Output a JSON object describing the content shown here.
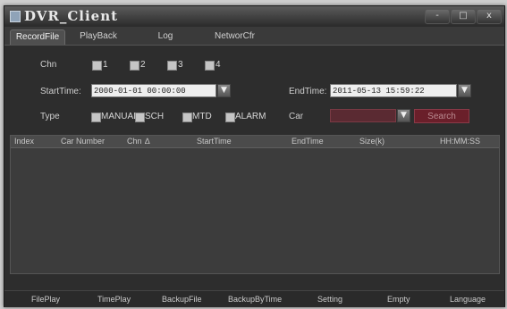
{
  "window": {
    "title": "DVR_Client",
    "min_label": "-",
    "max_label": "□",
    "close_label": "x"
  },
  "tabs": [
    {
      "label": "RecordFile",
      "active": true
    },
    {
      "label": "PlayBack"
    },
    {
      "label": "Log"
    },
    {
      "label": "NetworCfr"
    }
  ],
  "filters": {
    "chn_label": "Chn",
    "channels": [
      "1",
      "2",
      "3",
      "4"
    ],
    "start_label": "StartTime:",
    "start_value": "2000-01-01 00:00:00",
    "end_label": "EndTime:",
    "end_value": "2011-05-13 15:59:22",
    "type_label": "Type",
    "types": [
      "MANUAL",
      "SCH",
      "MTD",
      "ALARM"
    ],
    "car_label": "Car",
    "car_value": "",
    "search_label": "Search"
  },
  "table": {
    "columns": [
      "Index",
      "Car Number",
      "Chn",
      "StartTime",
      "EndTime",
      "Size(k)",
      "HH:MM:SS"
    ],
    "rows": []
  },
  "bottom_buttons": [
    "FilePlay",
    "TimePlay",
    "BackupFile",
    "BackupByTime",
    "Setting",
    "Empty",
    "Language"
  ],
  "colors": {
    "background": "#2d2d2d",
    "search_button": "#6a1f2a"
  }
}
